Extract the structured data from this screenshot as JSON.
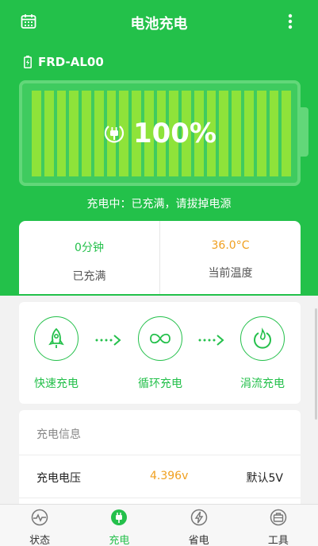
{
  "header": {
    "title": "电池充电",
    "calendar_icon": "calendar-icon",
    "more_icon": "more-vert-icon"
  },
  "device": {
    "name": "FRD-AL00",
    "icon": "battery-small-icon"
  },
  "battery": {
    "percent_text": "100%",
    "level_fraction": 1.0,
    "cell_count": 21,
    "icon": "plug-icon"
  },
  "status_text": "充电中：已充满，请拔掉电源",
  "stats": [
    {
      "value": "0分钟",
      "label": "已充满",
      "color": "#24c04b"
    },
    {
      "value": "36.0°C",
      "label": "当前温度",
      "color": "#f0a020"
    }
  ],
  "modes": [
    {
      "label": "快速充电",
      "icon": "rocket-icon"
    },
    {
      "label": "循环充电",
      "icon": "infinity-icon"
    },
    {
      "label": "涓流充电",
      "icon": "trickle-drop-icon"
    }
  ],
  "info": {
    "header": "充电信息",
    "rows": [
      {
        "key": "充电电压",
        "value": "4.396v",
        "default": "默认5V"
      }
    ]
  },
  "nav": [
    {
      "label": "状态",
      "icon": "pulse-icon",
      "active": false
    },
    {
      "label": "充电",
      "icon": "plug-icon",
      "active": true
    },
    {
      "label": "省电",
      "icon": "bolt-icon",
      "active": false
    },
    {
      "label": "工具",
      "icon": "toolbox-icon",
      "active": false
    }
  ],
  "colors": {
    "accent": "#23c14a",
    "warn": "#f0a020",
    "cell": "#8ee33a"
  }
}
